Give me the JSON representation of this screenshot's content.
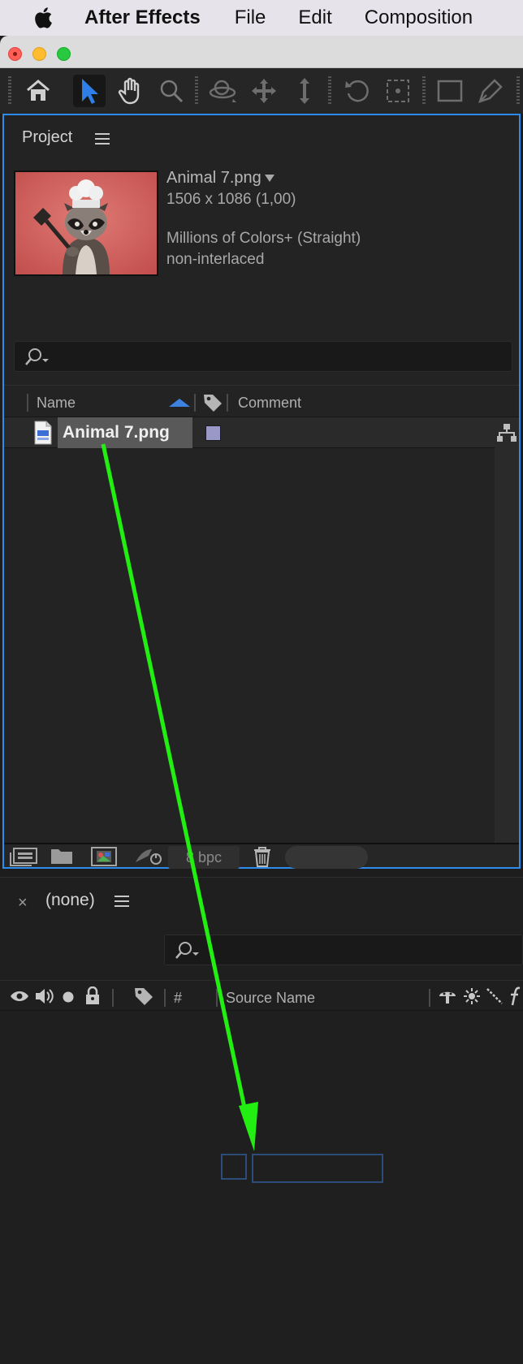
{
  "menubar": {
    "app_name": "After Effects",
    "items": [
      "File",
      "Edit",
      "Composition"
    ]
  },
  "project_panel": {
    "title": "Project",
    "footage": {
      "name": "Animal 7.png",
      "dimensions": "1506 x 1086 (1,00)",
      "color_info": "Millions of Colors+ (Straight)",
      "interlace": "non-interlaced"
    },
    "columns": {
      "name": "Name",
      "comment": "Comment"
    },
    "items": [
      {
        "name": "Animal 7.png",
        "label_color": "#9a98c6"
      }
    ],
    "bit_depth": "8 bpc"
  },
  "timeline_panel": {
    "close": "×",
    "title": "(none)",
    "columns": {
      "number": "#",
      "source_name": "Source Name"
    }
  },
  "colors": {
    "accent_blue": "#2d8ceb",
    "annotation_arrow": "#22ee11"
  }
}
